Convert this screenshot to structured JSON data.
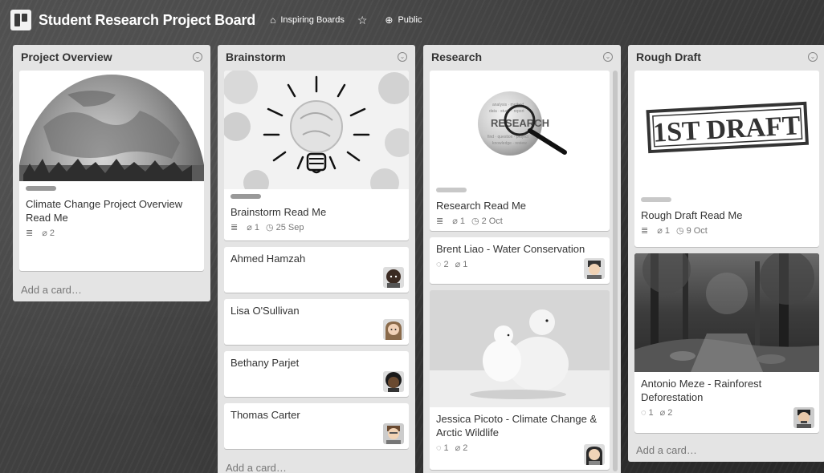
{
  "header": {
    "title": "Student Research Project Board",
    "team": "Inspiring Boards",
    "visibility": "Public"
  },
  "lists": [
    {
      "title": "Project Overview",
      "add_card": "Add a card…",
      "cards": [
        {
          "title": "Climate Change Project Overview Read Me",
          "attachments": "2"
        }
      ]
    },
    {
      "title": "Brainstorm",
      "add_card": "Add a card…",
      "cards": [
        {
          "title": "Brainstorm Read Me",
          "attachments": "1",
          "due": "25 Sep"
        },
        {
          "title": "Ahmed Hamzah"
        },
        {
          "title": "Lisa O'Sullivan"
        },
        {
          "title": "Bethany Parjet"
        },
        {
          "title": "Thomas Carter"
        }
      ]
    },
    {
      "title": "Research",
      "cards": [
        {
          "title": "Research Read Me",
          "attachments": "1",
          "due": "2 Oct"
        },
        {
          "title": "Brent Liao - Water Conservation",
          "comments": "2",
          "attachments": "1"
        },
        {
          "title": "Jessica Picoto - Climate Change & Arctic Wildlife",
          "comments": "1",
          "attachments": "2"
        }
      ]
    },
    {
      "title": "Rough Draft",
      "add_card": "Add a card…",
      "cards": [
        {
          "title": "Rough Draft Read Me",
          "attachments": "1",
          "due": "9 Oct"
        },
        {
          "title": "Antonio Meze - Rainforest Deforestation",
          "comments": "1",
          "attachments": "2"
        }
      ]
    }
  ],
  "cover_text": {
    "draft": "1ST DRAFT",
    "research": "RESEARCH"
  },
  "icons": {
    "description": "description-icon",
    "attachment": "paperclip-icon",
    "due": "clock-icon",
    "comment": "comment-icon"
  }
}
